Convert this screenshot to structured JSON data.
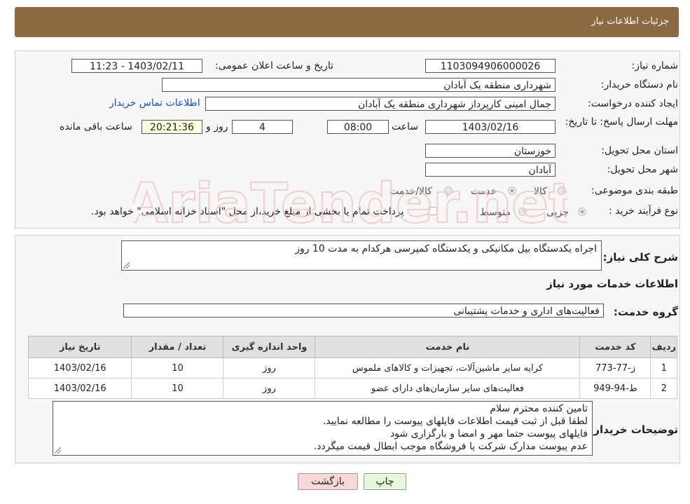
{
  "header": {
    "title": "جزئیات اطلاعات نیاز"
  },
  "form": {
    "need_number_label": "شماره نیاز:",
    "need_number": "1103094906000026",
    "announce_label": "تاریخ و ساعت اعلان عمومی:",
    "announce_value": "1403/02/11 - 11:23",
    "buyer_org_label": "نام دستگاه خریدار:",
    "buyer_org": "شهرداری منطقه یک آبادان",
    "creator_label": "ایجاد کننده درخواست:",
    "creator": "جمال امینی کارپرداز شهرداری منطقه یک آبادان",
    "contact_link": "اطلاعات تماس خریدار",
    "deadline_label": "مهلت ارسال پاسخ: تا تاریخ:",
    "deadline_date": "1403/02/16",
    "time_label": "ساعت",
    "deadline_time": "08:00",
    "days_value": "4",
    "days_label": "روز و",
    "remaining_time": "20:21:36",
    "remaining_label": "ساعت باقی مانده",
    "province_label": "استان محل تحویل:",
    "province": "خوزستان",
    "city_label": "شهر محل تحویل:",
    "city": "آبادان",
    "category_label": "طبقه بندی موضوعی:",
    "category_options": [
      "کالا",
      "خدمت",
      "کالا/خدمت"
    ],
    "process_label": "نوع فرآیند خرید :",
    "process_options": [
      "جزیی",
      "متوسط"
    ],
    "payment_note": "پرداخت تمام یا بخشی از مبلغ خرید،از محل \"اسناد خزانه اسلامی\" خواهد بود."
  },
  "details": {
    "summary_label": "شرح کلی نیاز:",
    "summary": "اجراه یکدستگاه بیل مکانیکی و یکدستگاه کمپرسی هرکدام به مدت 10 روز",
    "services_title": "اطلاعات خدمات مورد نیاز",
    "group_label": "گروه خدمت:",
    "group_value": "فعالیت‌های اداری و خدمات پشتیبانی",
    "table": {
      "headers": [
        "ردیف",
        "کد خدمت",
        "نام خدمت",
        "واحد اندازه گیری",
        "تعداد / مقدار",
        "تاریخ نیاز"
      ],
      "rows": [
        [
          "1",
          "ز-77-773",
          "کرایه سایر ماشین‌آلات، تجهیزات و کالاهای ملموس",
          "روز",
          "10",
          "1403/02/16"
        ],
        [
          "2",
          "ط-94-949",
          "فعالیت‌های سایر سازمان‌های دارای عضو",
          "روز",
          "10",
          "1403/02/16"
        ]
      ]
    },
    "buyer_notes_label": "توضیحات خریدار:",
    "buyer_notes": [
      "تامین کننده محترم سلام",
      "لطفا قبل از ثبت قیمت اطلاعات فایلهای پیوست را مطالعه نمایید.",
      "فایلهای پیوست حتما مهر و امضا و بارگزاری شود",
      "عدم پیوست مدارک شرکت یا فروشگاه موجب ابطال قیمت میگردد."
    ]
  },
  "buttons": {
    "print": "چاپ",
    "back": "بازگشت"
  },
  "watermark": "AriaTender.net",
  "colors": {
    "header_bg": "#8b6a43",
    "back_button_bg": "#f8d8d8",
    "print_button_bg": "#e6f7dc",
    "highlight_bg": "#ffffe0"
  }
}
